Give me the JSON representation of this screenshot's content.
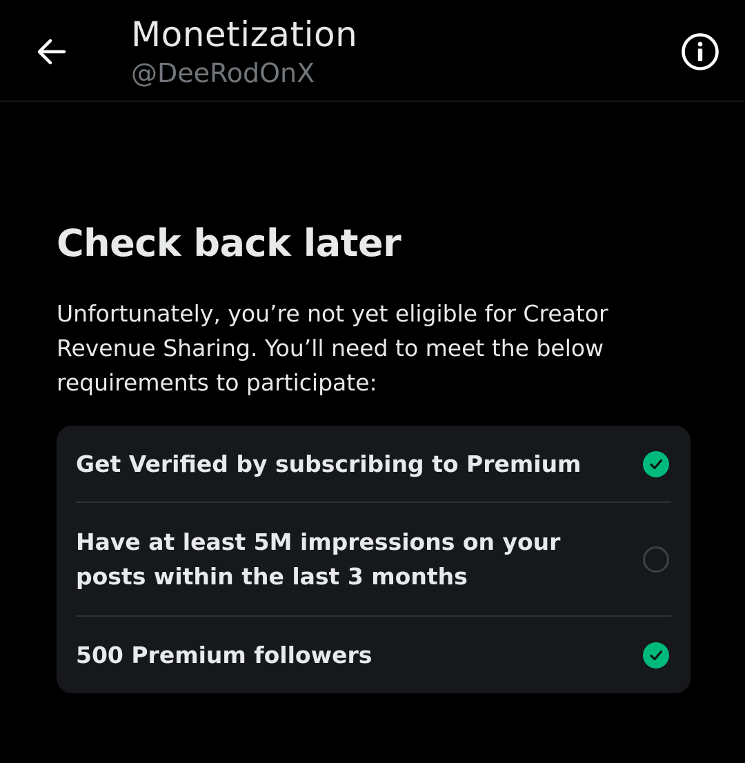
{
  "header": {
    "title": "Monetization",
    "handle": "@DeeRodOnX",
    "back_icon": "arrow-left-icon",
    "info_icon": "info-icon"
  },
  "main": {
    "heading": "Check back later",
    "description": "Unfortunately, you’re not yet eligible for Creator Revenue Sharing. You’ll need to meet the below requirements to participate:"
  },
  "requirements": [
    {
      "label": "Get Verified by subscribing to Premium",
      "met": true
    },
    {
      "label": "Have at least 5M impressions on your posts within the last 3 months",
      "met": false
    },
    {
      "label": "500 Premium followers",
      "met": true
    }
  ],
  "colors": {
    "background": "#000000",
    "card": "#16181c",
    "check_green": "#00ba7c",
    "text_primary": "#e7e9ea",
    "text_secondary": "#71767b",
    "divider": "#2f3336"
  }
}
